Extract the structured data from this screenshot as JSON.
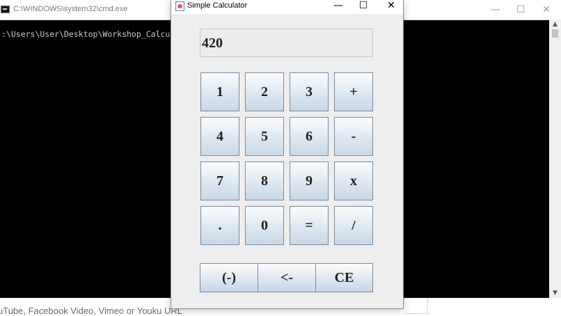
{
  "cmd": {
    "title": "C:\\WINDOWS\\system32\\cmd.exe",
    "line": ":\\Users\\User\\Desktop\\Workshop_Calcula",
    "minimize": "—",
    "maximize": "☐",
    "close": "✕"
  },
  "browser": {
    "text": "uTube, Facebook Video, Vimeo or Youku URL"
  },
  "calculator": {
    "title": "Simple Calculator",
    "minimize": "—",
    "maximize": "☐",
    "close": "✕",
    "display": "420",
    "keys": [
      "1",
      "2",
      "3",
      "+",
      "4",
      "5",
      "6",
      "-",
      "7",
      "8",
      "9",
      "x",
      ".",
      "0",
      "=",
      "/"
    ],
    "bottom_keys": [
      "(-)",
      "<-",
      "CE"
    ]
  }
}
